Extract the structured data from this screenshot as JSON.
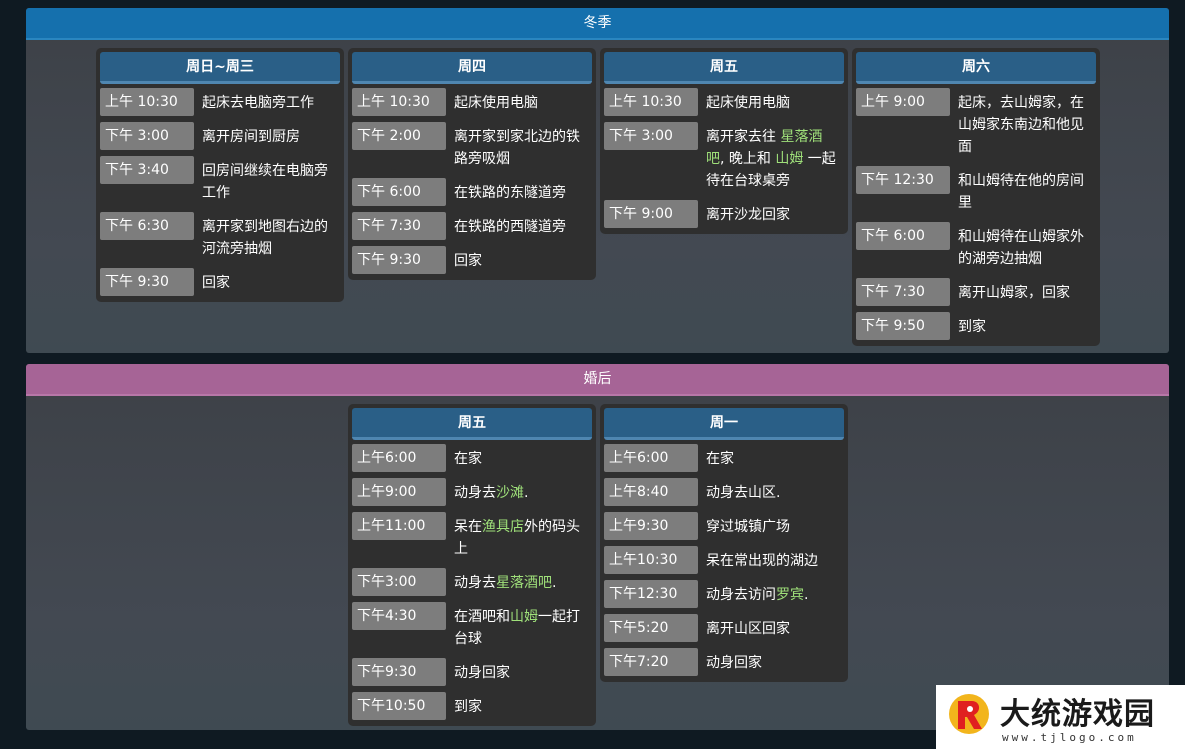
{
  "winter": {
    "title": "冬季",
    "columns": [
      {
        "day": "周日~周三",
        "rows": [
          {
            "time": "上午 10:30",
            "desc": "起床去电脑旁工作"
          },
          {
            "time": "下午 3:00",
            "desc": "离开房间到厨房"
          },
          {
            "time": "下午 3:40",
            "desc": "回房间继续在电脑旁工作"
          },
          {
            "time": "下午 6:30",
            "desc": "离开家到地图右边的河流旁抽烟"
          },
          {
            "time": "下午 9:30",
            "desc": "回家"
          }
        ]
      },
      {
        "day": "周四",
        "rows": [
          {
            "time": "上午 10:30",
            "desc": "起床使用电脑"
          },
          {
            "time": "下午 2:00",
            "desc": "离开家到家北边的铁路旁吸烟"
          },
          {
            "time": "下午 6:00",
            "desc": "在铁路的东隧道旁"
          },
          {
            "time": "下午 7:30",
            "desc": "在铁路的西隧道旁"
          },
          {
            "time": "下午 9:30",
            "desc": "回家"
          }
        ]
      },
      {
        "day": "周五",
        "rows": [
          {
            "time": "上午 10:30",
            "desc": "起床使用电脑"
          },
          {
            "time": "下午 3:00",
            "desc_a": "离开家去往 ",
            "link_1": "星落酒吧",
            "desc_b": ", 晚上和 ",
            "link_2": "山姆",
            "desc_c": " 一起待在台球桌旁"
          },
          {
            "time": "下午 9:00",
            "desc": "离开沙龙回家"
          }
        ]
      },
      {
        "day": "周六",
        "rows": [
          {
            "time": "上午 9:00",
            "desc": "起床，去山姆家，在山姆家东南边和他见面"
          },
          {
            "time": "下午 12:30",
            "desc": "和山姆待在他的房间里"
          },
          {
            "time": "下午 6:00",
            "desc": "和山姆待在山姆家外的湖旁边抽烟"
          },
          {
            "time": "下午 7:30",
            "desc": "离开山姆家，回家"
          },
          {
            "time": "下午 9:50",
            "desc": "到家"
          }
        ]
      }
    ]
  },
  "married": {
    "title": "婚后",
    "columns": [
      {
        "day": "周五",
        "rows": [
          {
            "time": "上午6:00",
            "desc": "在家"
          },
          {
            "time": "上午9:00",
            "desc_a": "动身去",
            "link_1": "沙滩",
            "desc_b": "."
          },
          {
            "time": "上午11:00",
            "desc_a": "呆在",
            "link_1": "渔具店",
            "desc_b": "外的码头上"
          },
          {
            "time": "下午3:00",
            "desc_a": "动身去",
            "link_1": "星落酒吧",
            "desc_b": "."
          },
          {
            "time": "下午4:30",
            "desc_a": "在酒吧和",
            "link_1": "山姆",
            "desc_b": "一起打台球"
          },
          {
            "time": "下午9:30",
            "desc": "动身回家"
          },
          {
            "time": "下午10:50",
            "desc": "到家"
          }
        ]
      },
      {
        "day": "周一",
        "rows": [
          {
            "time": "上午6:00",
            "desc": "在家"
          },
          {
            "time": "上午8:40",
            "desc": "动身去山区."
          },
          {
            "time": "上午9:30",
            "desc": "穿过城镇广场"
          },
          {
            "time": "上午10:30",
            "desc": "呆在常出现的湖边"
          },
          {
            "time": "下午12:30",
            "desc_a": "动身去访问",
            "link_1": "罗宾",
            "desc_b": "."
          },
          {
            "time": "下午5:20",
            "desc": "离开山区回家"
          },
          {
            "time": "下午7:20",
            "desc": "动身回家"
          }
        ]
      }
    ]
  },
  "watermark": {
    "brand": "大统游戏园",
    "url": "www.tjlogo.com"
  },
  "colors": {
    "winter_header": "#1570ad",
    "married_header": "#a66496",
    "day_header": "#2a5f87",
    "highlight": "#9fe07a"
  }
}
